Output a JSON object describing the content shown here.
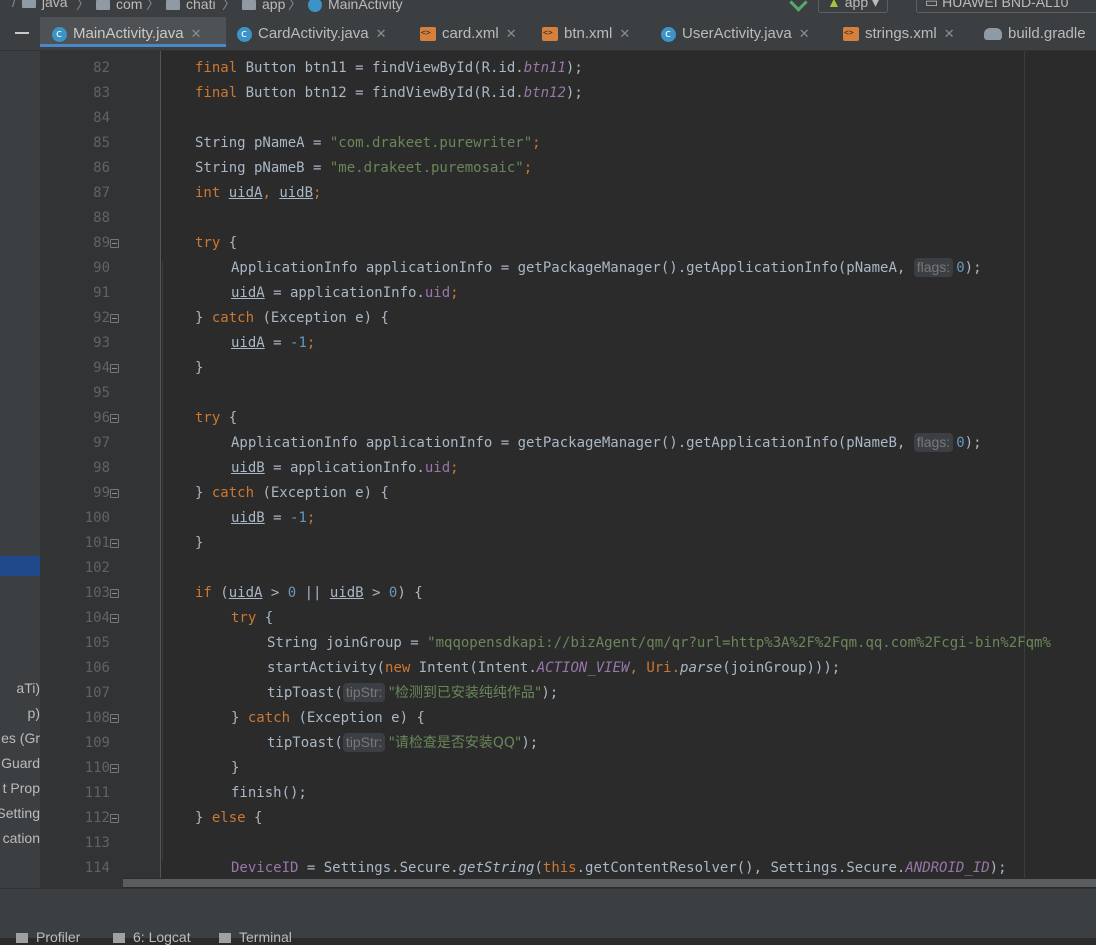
{
  "breadcrumb": {
    "items": [
      "java",
      "com",
      "chati",
      "app",
      "MainActivity"
    ]
  },
  "run_config": {
    "module": "app",
    "device": "HUAWEI BND-AL10"
  },
  "tabs": [
    {
      "label": "MainActivity.java",
      "icon": "java-class-icon",
      "active": true
    },
    {
      "label": "CardActivity.java",
      "icon": "java-class-icon",
      "active": false
    },
    {
      "label": "card.xml",
      "icon": "xml-file-icon",
      "active": false
    },
    {
      "label": "btn.xml",
      "icon": "xml-file-icon",
      "active": false
    },
    {
      "label": "UserActivity.java",
      "icon": "java-class-icon",
      "active": false
    },
    {
      "label": "strings.xml",
      "icon": "xml-file-icon",
      "active": false
    },
    {
      "label": "build.gradle",
      "icon": "gradle-file-icon",
      "active": false
    }
  ],
  "sidebar_fragments": [
    "aTi)",
    "p)",
    "es (Gr",
    "Guard",
    "t Prop",
    "Setting",
    "cation"
  ],
  "code": {
    "line_numbers": [
      "82",
      "83",
      "84",
      "85",
      "86",
      "87",
      "88",
      "89",
      "90",
      "91",
      "92",
      "93",
      "94",
      "95",
      "96",
      "97",
      "98",
      "99",
      "100",
      "101",
      "102",
      "103",
      "104",
      "105",
      "106",
      "107",
      "108",
      "109",
      "110",
      "111",
      "112",
      "113",
      "114"
    ],
    "l82_a": "final",
    "l82_b": " Button btn11 = findViewById(R.id.",
    "l82_c": "btn11",
    "l82_d": ");",
    "l83_a": "final",
    "l83_b": " Button btn12 = findViewById(R.id.",
    "l83_c": "btn12",
    "l83_d": ");",
    "l85_a": "String pNameA = ",
    "l85_b": "\"com.drakeet.purewriter\"",
    "l85_c": ";",
    "l86_a": "String pNameB = ",
    "l86_b": "\"me.drakeet.puremosaic\"",
    "l86_c": ";",
    "l87_a": "int",
    "l87_b": " ",
    "l87_c": "uidA",
    "l87_d": ", ",
    "l87_e": "uidB",
    "l87_f": ";",
    "try_kw": "try",
    "brace_open": " {",
    "l90_a": "ApplicationInfo applicationInfo = getPackageManager().getApplicationInfo(pNameA, ",
    "l97_a": "ApplicationInfo applicationInfo = getPackageManager().getApplicationInfo(pNameB, ",
    "hint_flags": "flags:",
    "zero": "0",
    "close_paren_semi": ");",
    "uidA": "uidA",
    "uidB": "uidB",
    "assign_appinfo": " = applicationInfo.",
    "uid_field": "uid",
    "semi": ";",
    "close_brace": "}",
    "catch_close": "} ",
    "catch_kw": "catch",
    "catch_rest": " (Exception e) {",
    "assign": " = ",
    "minus_one": "-1",
    "if_kw": "if",
    "if_a": " (",
    "gt": " > ",
    "or": " || ",
    "if_b": ") {",
    "l105_a": "String joinGroup = ",
    "l105_b": "\"mqqopensdkapi://bizAgent/qm/qr?url=http%3A%2F%2Fqm.qq.com%2Fcgi-bin%2Fqm%",
    "l106_a": "startActivity(",
    "l106_new": "new",
    "l106_b": " Intent(Intent.",
    "l106_c": "ACTION_VIEW",
    "l106_d": ", Uri.",
    "l106_e": "parse",
    "l106_f": "(joinGroup)));",
    "tiptoast": "tipToast(",
    "hint_tipstr": "tipStr:",
    "l107_str": "\"检测到已安装纯纯作品\"",
    "l109_str": "\"请检查是否安装QQ\"",
    "finish": "finish();",
    "else_kw": "else",
    "l114_a": "DeviceID",
    "l114_b": " = Settings.Secure.",
    "l114_c": "getString",
    "l114_d": "(",
    "l114_this": "this",
    "l114_e": ".getContentResolver(), Settings.Secure.",
    "l114_f": "ANDROID_ID",
    "l114_g": ");"
  },
  "bottom_tools": [
    "Profiler",
    "6: Logcat",
    "Terminal"
  ]
}
